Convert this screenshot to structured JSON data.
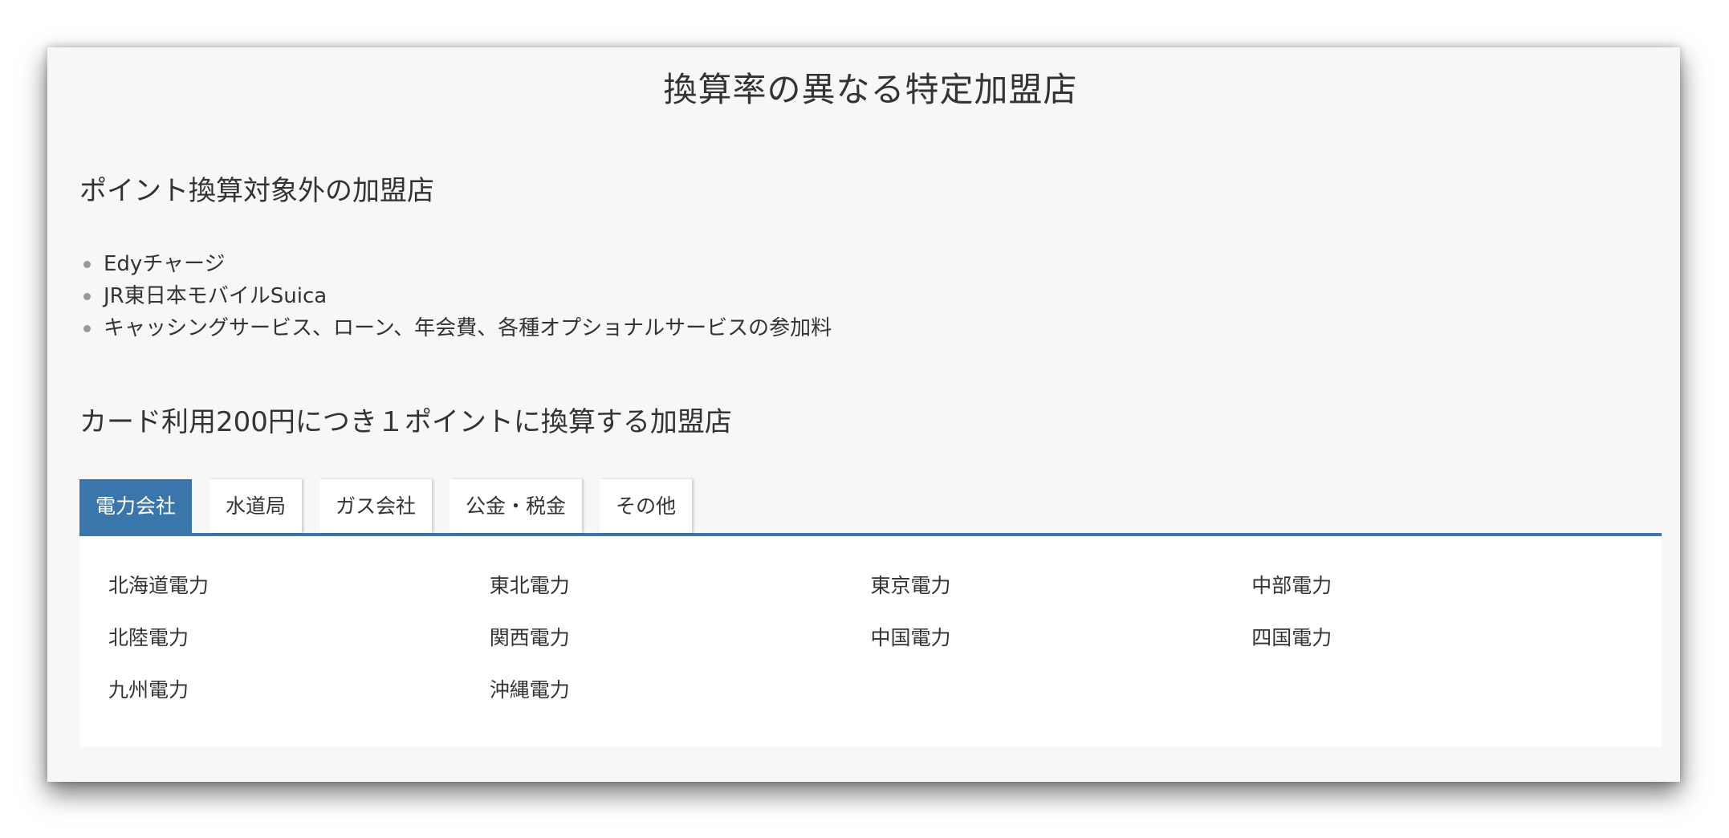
{
  "page": {
    "title": "換算率の異なる特定加盟店"
  },
  "section_excluded": {
    "title": "ポイント換算対象外の加盟店",
    "items": [
      "Edyチャージ",
      "JR東日本モバイルSuica",
      "キャッシングサービス、ローン、年会費、各種オプショナルサービスの参加料"
    ]
  },
  "section_rate": {
    "title": "カード利用200円につき１ポイントに換算する加盟店",
    "tabs": [
      {
        "label": "電力会社",
        "active": true
      },
      {
        "label": "水道局",
        "active": false
      },
      {
        "label": "ガス会社",
        "active": false
      },
      {
        "label": "公金・税金",
        "active": false
      },
      {
        "label": "その他",
        "active": false
      }
    ],
    "companies": [
      "北海道電力",
      "東北電力",
      "東京電力",
      "中部電力",
      "北陸電力",
      "関西電力",
      "中国電力",
      "四国電力",
      "九州電力",
      "沖縄電力"
    ]
  },
  "colors": {
    "accent": "#3a76ab",
    "window_bg": "#f7f7f7",
    "panel_bg": "#ffffff",
    "text": "#333333"
  }
}
